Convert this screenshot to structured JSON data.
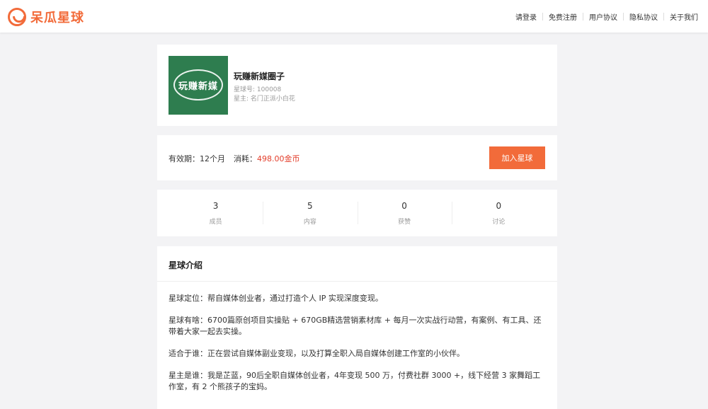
{
  "header": {
    "logo_text": "呆瓜星球",
    "nav": [
      "请登录",
      "免费注册",
      "用户协议",
      "隐私协议",
      "关于我们"
    ]
  },
  "group": {
    "image_text": "玩赚新媒",
    "name": "玩赚新媒圈子",
    "id_line": "星球号: 100008",
    "owner_line": "星主: 名门正派小白花"
  },
  "membership": {
    "validity_label": "有效期：",
    "validity_value": "12个月",
    "cost_label": "消耗：",
    "cost_value": "498.00金币",
    "join_button": "加入星球"
  },
  "stats": [
    {
      "value": "3",
      "label": "成员"
    },
    {
      "value": "5",
      "label": "内容"
    },
    {
      "value": "0",
      "label": "获赞"
    },
    {
      "value": "0",
      "label": "讨论"
    }
  ],
  "intro": {
    "title": "星球介绍",
    "paragraphs": [
      "星球定位：帮自媒体创业者，通过打造个人 IP 实现深度变现。",
      "星球有啥：6700篇原创项目实操贴 + 670GB精选营销素材库 + 每月一次实战行动营，有案例、有工具、还带着大家一起去实操。",
      "适合于谁：正在尝试自媒体副业变现，以及打算全职入局自媒体创建工作室的小伙伴。",
      "星主是谁：我是芷蓝，90后全职自媒体创业者，4年变现 500 万，付费社群 3000 +，线下经营 3 家舞蹈工作室，有 2 个熊孩子的宝妈。"
    ]
  },
  "colors": {
    "accent": "#f26b3a",
    "price_red": "#e33e2b",
    "group_image_bg": "#2e7d4f"
  }
}
